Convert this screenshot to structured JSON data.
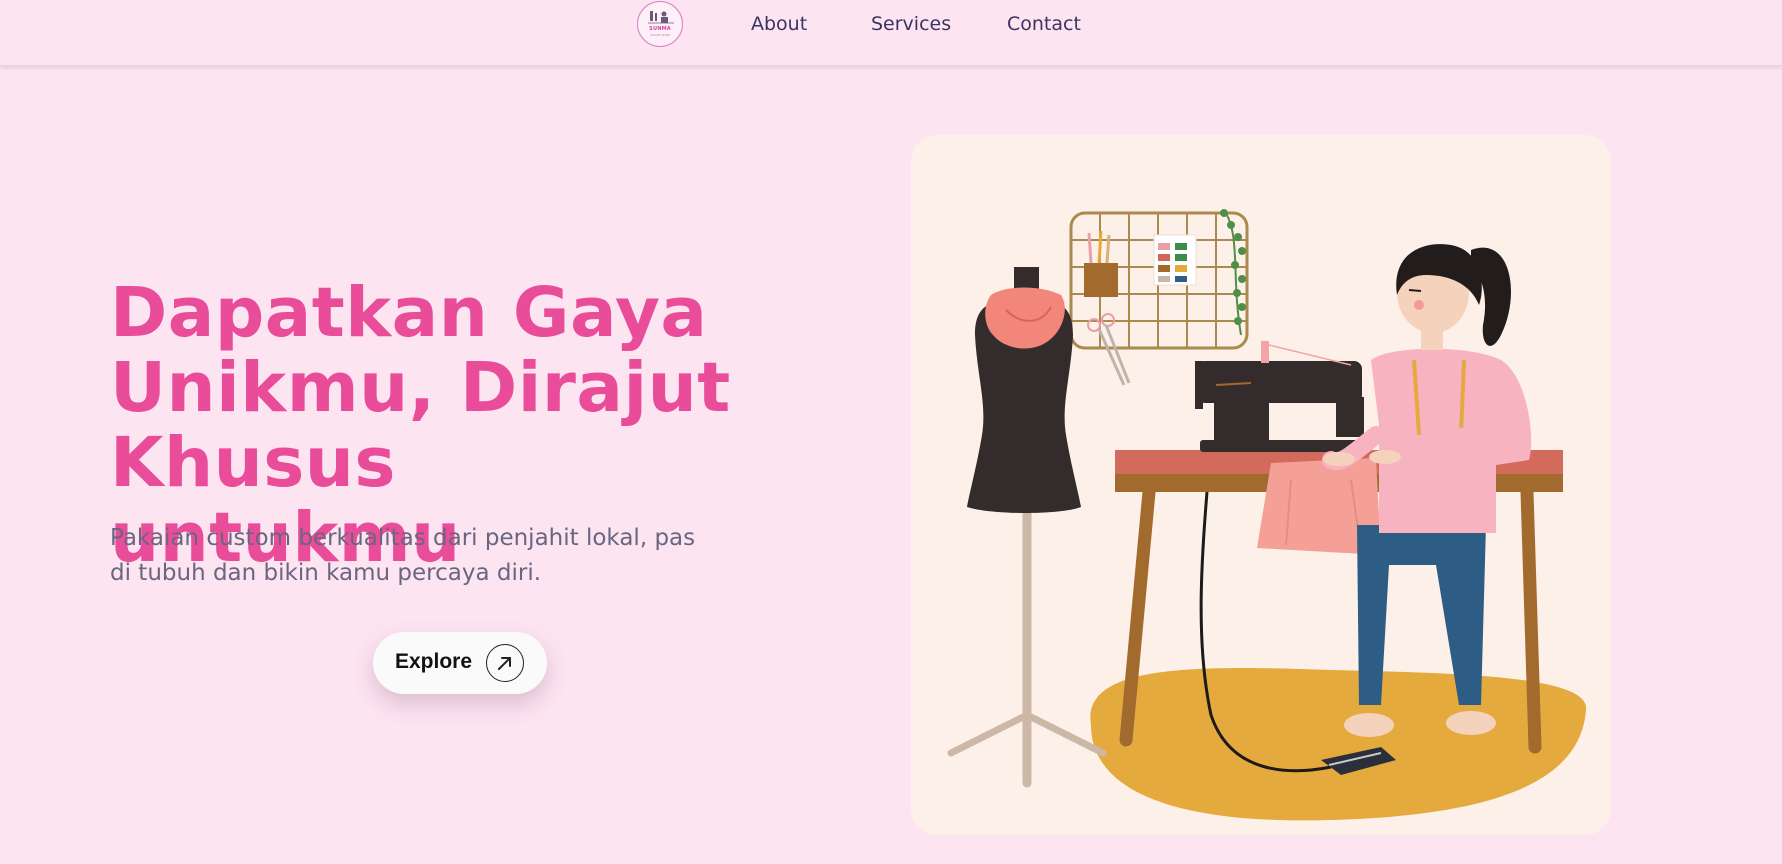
{
  "nav": {
    "logo_brand": "SUNMA",
    "logo_tagline": "TAILOR SHOP",
    "links": [
      {
        "label": "About"
      },
      {
        "label": "Services"
      },
      {
        "label": "Contact"
      }
    ]
  },
  "hero": {
    "title_line1": "Dapatkan Gaya",
    "title_line2": "Unikmu, Dirajut",
    "title_line3": "Khusus untukmu",
    "subtitle_line1": "Pakaian custom berkualitas dari penjahit lokal, pas",
    "subtitle_line2": "di tubuh dan bikin kamu percaya diri.",
    "cta_label": "Explore"
  },
  "colors": {
    "background": "#fde4f1",
    "accent": "#e94d99",
    "text_muted": "#6a6580",
    "nav_text": "#3a3560",
    "card_bg": "#fdf0e8"
  },
  "illustration": {
    "subject": "woman sewing at sewing machine beside dress mannequin"
  }
}
